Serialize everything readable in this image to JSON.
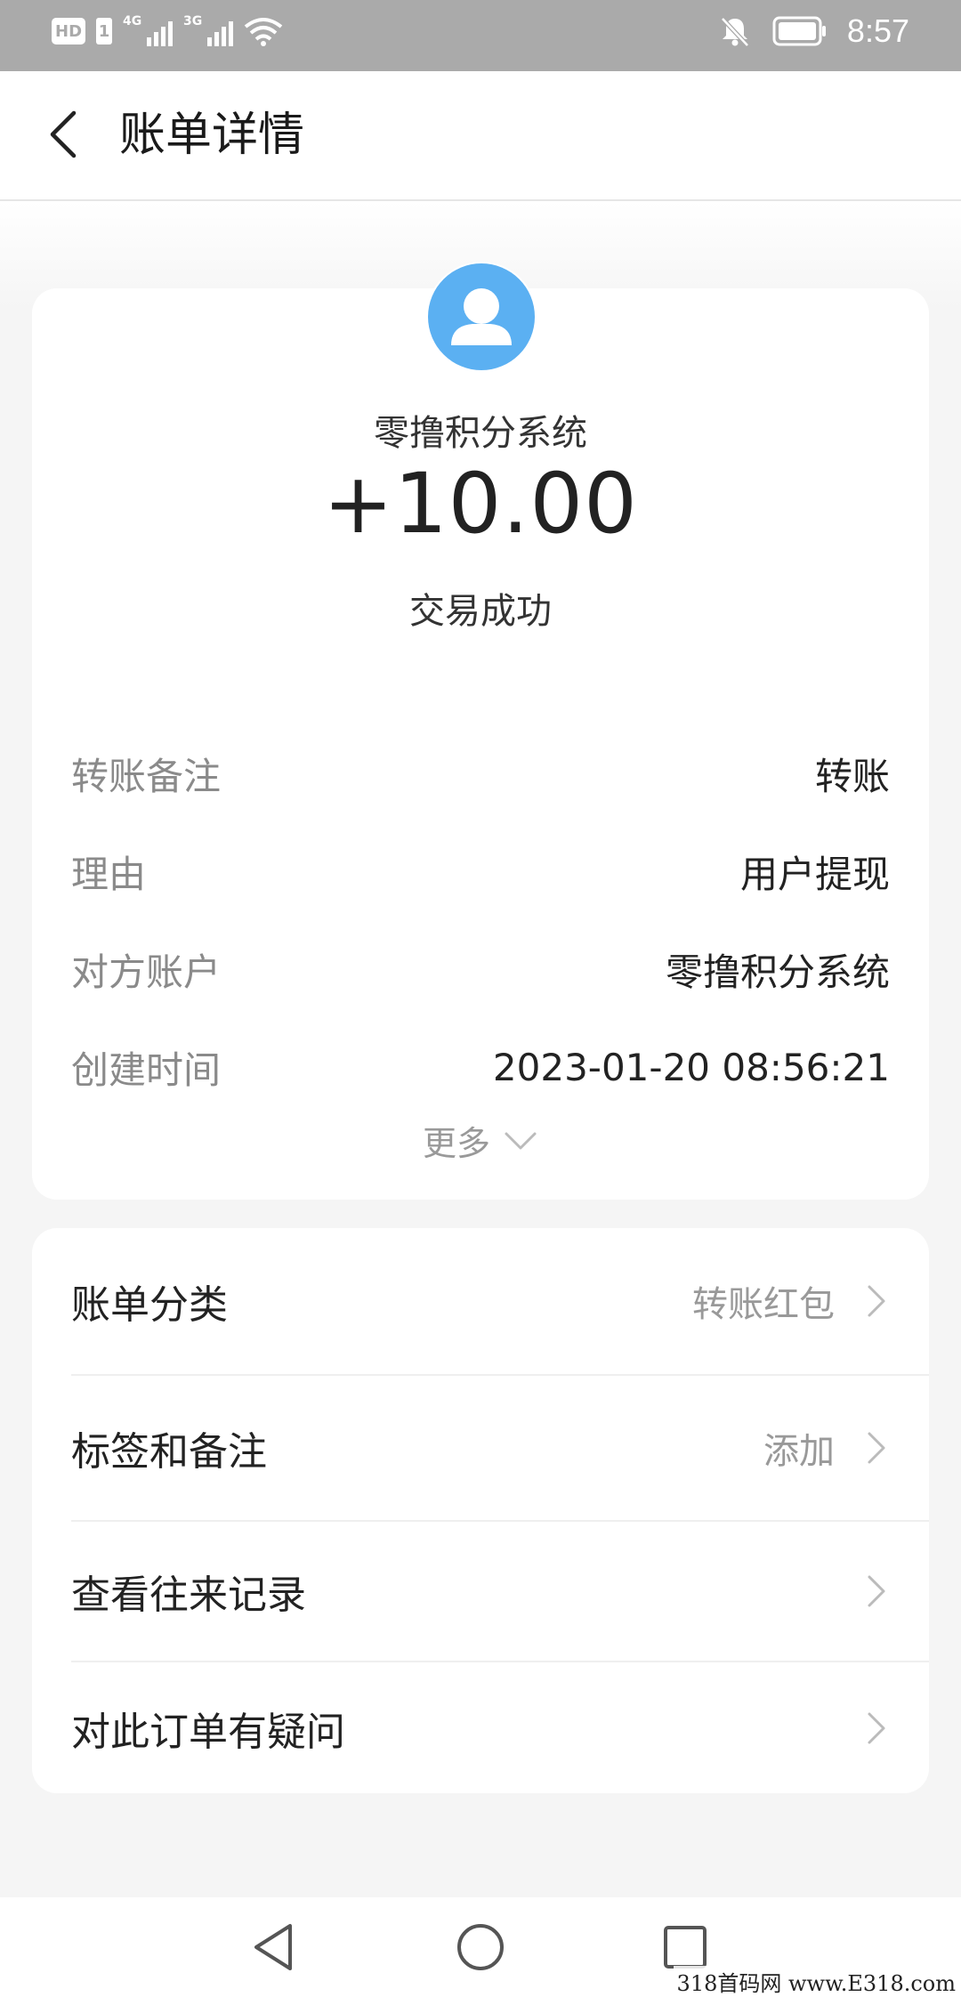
{
  "status_bar": {
    "badge": "HD",
    "sim_slot": "1",
    "net1": "4G",
    "net2": "3G",
    "time": "8:57"
  },
  "header": {
    "title": "账单详情"
  },
  "transaction": {
    "merchant": "零撸积分系统",
    "amount": "+10.00",
    "status": "交易成功",
    "details": [
      {
        "label": "转账备注",
        "value": "转账"
      },
      {
        "label": "理由",
        "value": "用户提现"
      },
      {
        "label": "对方账户",
        "value": "零撸积分系统"
      },
      {
        "label": "创建时间",
        "value": "2023-01-20 08:56:21"
      }
    ],
    "more_label": "更多"
  },
  "actions": [
    {
      "label": "账单分类",
      "value": "转账红包"
    },
    {
      "label": "标签和备注",
      "value": "添加"
    },
    {
      "label": "查看往来记录",
      "value": ""
    },
    {
      "label": "对此订单有疑问",
      "value": ""
    }
  ],
  "colors": {
    "status_bar_bg": "#aaaaaa",
    "avatar_bg": "#5bb0f2",
    "page_bg": "#f5f5f5"
  },
  "watermark": "318首码网 www.E318.com"
}
